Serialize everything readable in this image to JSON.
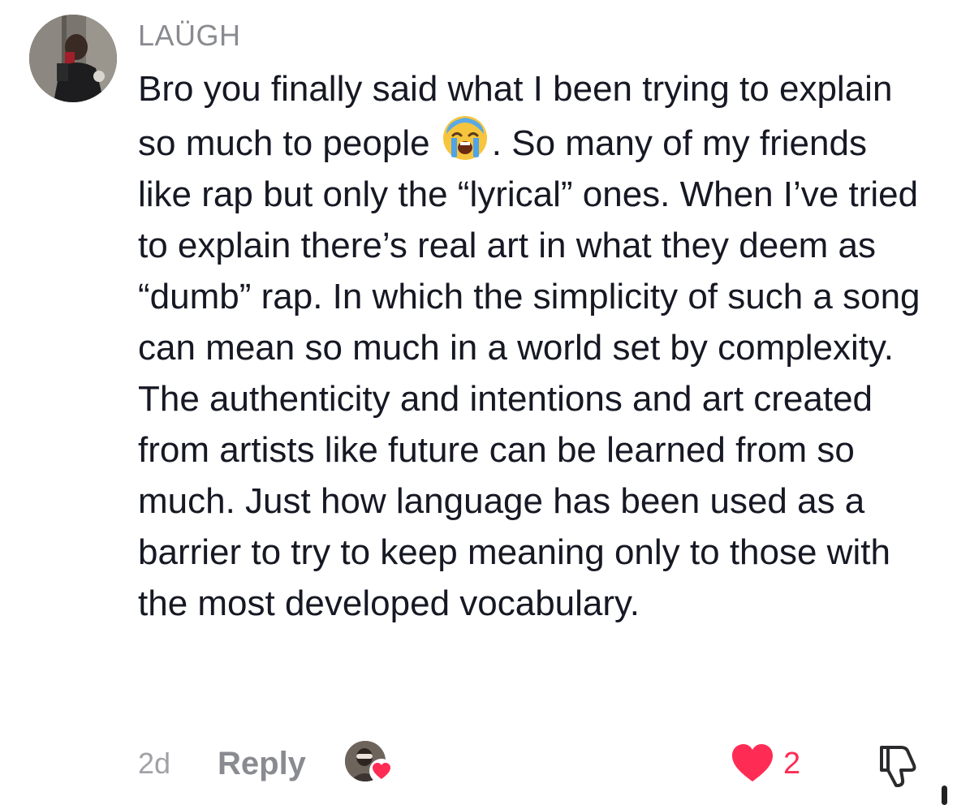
{
  "comment": {
    "username": "LAÜGH",
    "text_before_emoji": "Bro you finally said what I been trying to explain so much to people",
    "emoji_icon": "loudly-crying-face-emoji",
    "text_after_emoji": ". So many of my friends like rap but only the “lyrical” ones. When I’ve tried to explain there’s real art in what they deem as “dumb” rap. In which the simplicity of such a song can mean so much in a world set by complexity. The authenticity and intentions and art created from artists like future can be learned from so much. Just how language has been used as a barrier to try to keep meaning only to those with the most developed vocabulary.",
    "timestamp": "2d",
    "reply_label": "Reply",
    "like_count": "2",
    "liked": true,
    "liked_by_creator": true
  },
  "icons": {
    "avatar": "user-avatar",
    "creator_avatar": "creator-avatar",
    "creator_heart": "heart-icon",
    "like": "heart-filled-icon",
    "dislike": "thumbs-down-icon"
  },
  "colors": {
    "like_red": "#fe2c55",
    "username_gray": "#8a8b91",
    "text_dark": "#161823"
  }
}
